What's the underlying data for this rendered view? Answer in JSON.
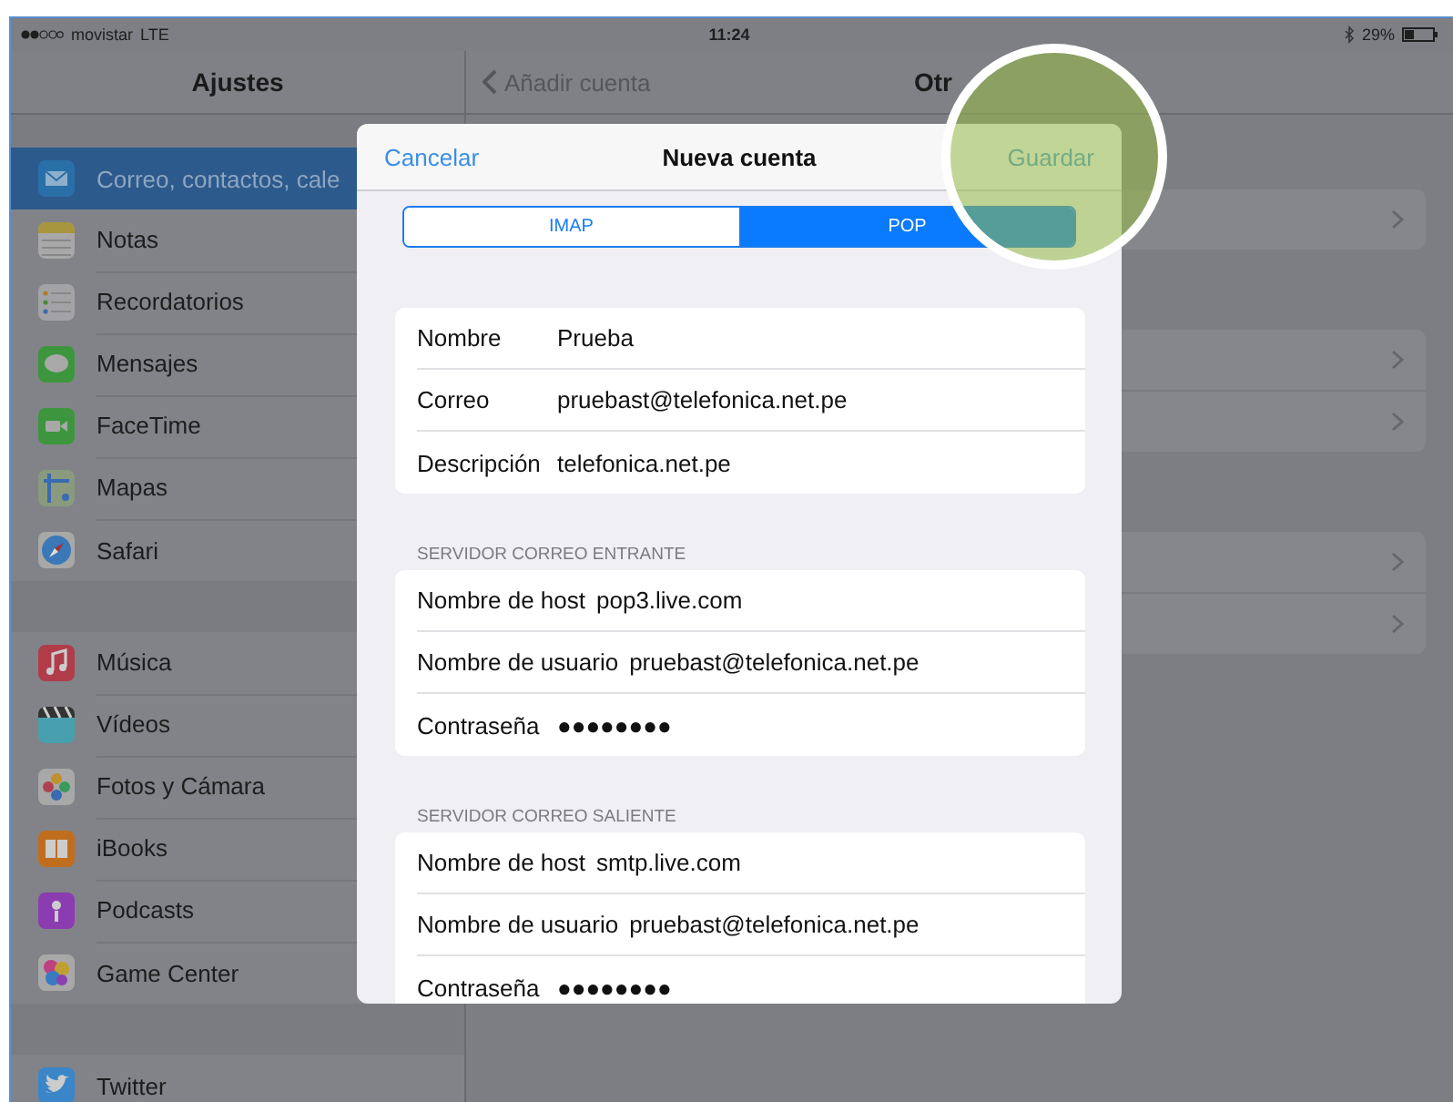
{
  "status_bar": {
    "carrier": "movistar",
    "network": "LTE",
    "time": "11:24",
    "battery": "29%"
  },
  "sidebar": {
    "title": "Ajustes",
    "groups": [
      {
        "items": [
          {
            "label": "Correo, contactos, cale",
            "kind": "mail",
            "selected": true
          },
          {
            "label": "Notas",
            "kind": "notes",
            "selected": false
          },
          {
            "label": "Recordatorios",
            "kind": "reminders",
            "selected": false
          },
          {
            "label": "Mensajes",
            "kind": "messages",
            "selected": false
          },
          {
            "label": "FaceTime",
            "kind": "facetime",
            "selected": false
          },
          {
            "label": "Mapas",
            "kind": "maps",
            "selected": false
          },
          {
            "label": "Safari",
            "kind": "safari",
            "selected": false
          }
        ]
      },
      {
        "items": [
          {
            "label": "Música",
            "kind": "music",
            "selected": false
          },
          {
            "label": "Vídeos",
            "kind": "videos",
            "selected": false
          },
          {
            "label": "Fotos y Cámara",
            "kind": "photos",
            "selected": false
          },
          {
            "label": "iBooks",
            "kind": "books",
            "selected": false
          },
          {
            "label": "Podcasts",
            "kind": "podcasts",
            "selected": false
          },
          {
            "label": "Game Center",
            "kind": "gamecenter",
            "selected": false
          }
        ]
      },
      {
        "items": [
          {
            "label": "Twitter",
            "kind": "twitter",
            "selected": false
          }
        ]
      }
    ]
  },
  "detail": {
    "back": "Añadir cuenta",
    "title": "Otr",
    "groups": [
      {
        "rows": [
          {
            "kind": "disclosure"
          }
        ]
      },
      {
        "rows": [
          {
            "kind": "disclosure"
          },
          {
            "kind": "disclosure"
          }
        ]
      },
      {
        "rows": [
          {
            "kind": "disclosure"
          },
          {
            "kind": "disclosure"
          }
        ]
      }
    ]
  },
  "modal": {
    "cancel": "Cancelar",
    "title": "Nueva cuenta",
    "save": "Guardar",
    "segments": [
      {
        "label": "IMAP",
        "selected": false
      },
      {
        "label": "POP",
        "selected": true
      }
    ],
    "sections": [
      {
        "rows": [
          {
            "label": "Nombre",
            "value": "Prueba"
          },
          {
            "label": "Correo",
            "value": "pruebast@telefonica.net.pe"
          },
          {
            "label": "Descripción",
            "value": "telefonica.net.pe"
          }
        ]
      },
      {
        "header": "SERVIDOR CORREO ENTRANTE",
        "rows": [
          {
            "label": "Nombre de host",
            "value": "pop3.live.com"
          },
          {
            "label": "Nombre de usuario",
            "value": "pruebast@telefonica.net.pe"
          },
          {
            "label": "Contraseña",
            "value": "●●●●●●●●"
          }
        ]
      },
      {
        "header": "SERVIDOR CORREO SALIENTE",
        "rows": [
          {
            "label": "Nombre de host",
            "value": "smtp.live.com"
          },
          {
            "label": "Nombre de usuario",
            "value": "pruebast@telefonica.net.pe"
          },
          {
            "label": "Contraseña",
            "value": "●●●●●●●●"
          }
        ]
      }
    ]
  }
}
